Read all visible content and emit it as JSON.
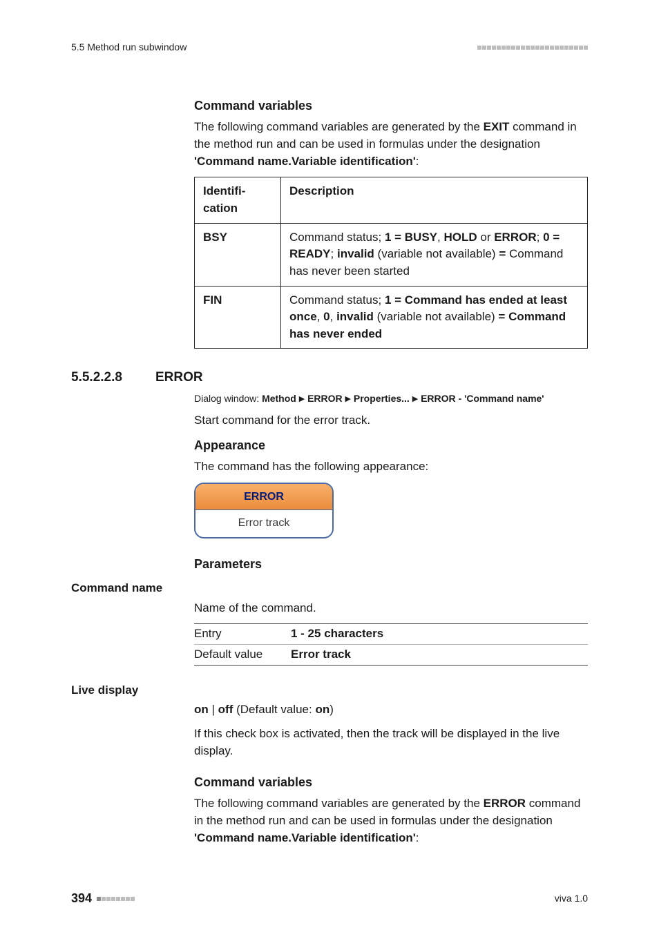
{
  "running_head": {
    "left": "5.5 Method run subwindow"
  },
  "cmd_vars_1": {
    "heading": "Command variables",
    "intro_pre": "The following command variables are generated by the ",
    "intro_cmd": "EXIT",
    "intro_mid": " command in the method run and can be used in formulas under the designation ",
    "intro_desig": "'Command name.Variable identification'",
    "intro_post": ":"
  },
  "var_table_1": {
    "col1": "Identification",
    "col2": "Description",
    "rows": [
      {
        "id": "BSY",
        "pre": "Command status; ",
        "s1": "1 = BUSY",
        "c1": ", ",
        "s2": "HOLD",
        "c2": " or ",
        "s3": "ERROR",
        "c3": "; ",
        "s4": "0 = READY",
        "c4": "; ",
        "s5": "invalid",
        "mid": " (variable not available) ",
        "eq": "=",
        "post": " Command has never been started"
      },
      {
        "id": "FIN",
        "pre": "Command status; ",
        "s1": "1 = Command has ended at least once",
        "c1": ", ",
        "s2": "0",
        "c2": ", ",
        "s3": "invalid",
        "mid": " (variable not available) ",
        "eq": "=",
        "c3": " ",
        "s4": "Command has never ended"
      }
    ]
  },
  "subsection": {
    "num": "5.5.2.2.8",
    "title": "ERROR"
  },
  "dialog": {
    "label": "Dialog window: ",
    "p1": "Method",
    "p2": "ERROR",
    "p3": "Properties...",
    "p4": "ERROR - 'Command name'"
  },
  "intro_line": "Start command for the error track.",
  "appearance": {
    "heading": "Appearance",
    "text": "The command has the following appearance:"
  },
  "widget": {
    "header": "ERROR",
    "body": "Error track"
  },
  "parameters_heading": "Parameters",
  "param_cmdname": {
    "label": "Command name",
    "desc": "Name of the command.",
    "entry_label": "Entry",
    "entry_value": "1 - 25 characters",
    "default_label": "Default value",
    "default_value": "Error track"
  },
  "param_live": {
    "label": "Live display",
    "on": "on",
    "sep": " | ",
    "off": "off",
    "dv_pre": " (Default value: ",
    "dv_val": "on",
    "dv_post": ")",
    "desc": "If this check box is activated, then the track will be displayed in the live display."
  },
  "cmd_vars_2": {
    "heading": "Command variables",
    "intro_pre": "The following command variables are generated by the ",
    "intro_cmd": "ERROR",
    "intro_mid": " command in the method run and can be used in formulas under the designation ",
    "intro_desig": "'Command name.Variable identification'",
    "intro_post": ":"
  },
  "footer": {
    "page": "394",
    "right": "viva 1.0"
  }
}
